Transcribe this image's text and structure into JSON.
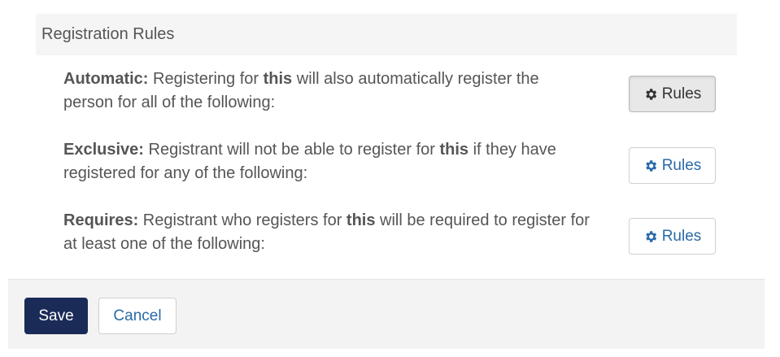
{
  "section": {
    "title": "Registration Rules"
  },
  "rules": [
    {
      "label": "Automatic:",
      "text_before": " Registering for ",
      "emphasis": "this",
      "text_after": " will also automatically register the person for all of the following:",
      "button_label": "Rules",
      "button_icon": "gear-icon",
      "button_state": "active"
    },
    {
      "label": "Exclusive:",
      "text_before": " Registrant will not be able to register for ",
      "emphasis": "this",
      "text_after": " if they have registered for any of the following:",
      "button_label": "Rules",
      "button_icon": "gear-icon",
      "button_state": "default"
    },
    {
      "label": "Requires:",
      "text_before": " Registrant who registers for ",
      "emphasis": "this",
      "text_after": " will be required to register for at least one of the following:",
      "button_label": "Rules",
      "button_icon": "gear-icon",
      "button_state": "default"
    }
  ],
  "footer": {
    "save_label": "Save",
    "cancel_label": "Cancel"
  },
  "colors": {
    "primary": "#1b2b57",
    "link": "#2a6aa8",
    "text": "#555555",
    "header_bg": "#f5f5f5",
    "footer_bg": "#f3f3f3"
  }
}
